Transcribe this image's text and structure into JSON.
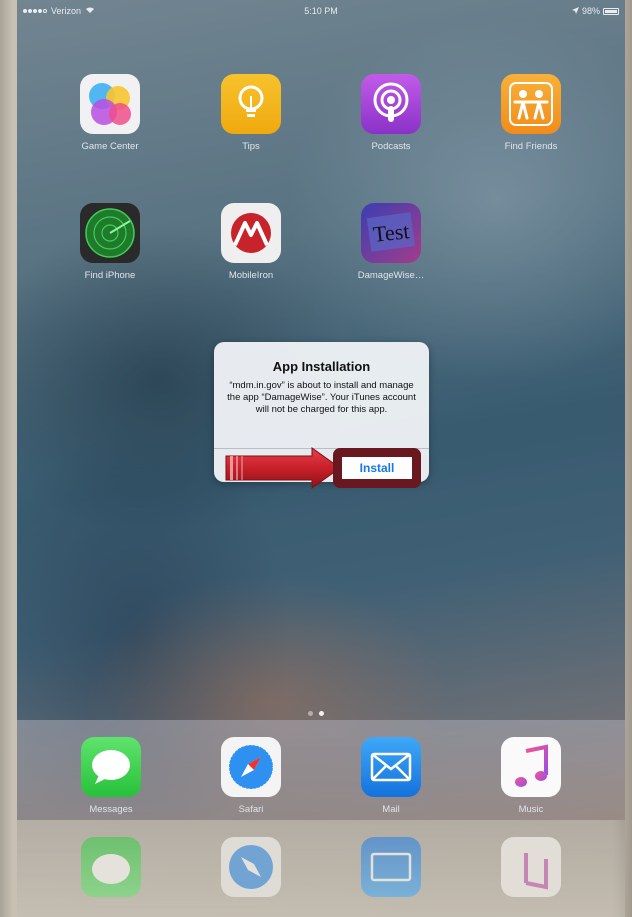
{
  "status_bar": {
    "carrier": "Verizon",
    "time": "5:10 PM",
    "battery": "98%"
  },
  "home_apps": [
    {
      "label": "Game Center",
      "icon": "game-center-icon"
    },
    {
      "label": "Tips",
      "icon": "tips-icon"
    },
    {
      "label": "Podcasts",
      "icon": "podcasts-icon"
    },
    {
      "label": "Find Friends",
      "icon": "find-friends-icon"
    },
    {
      "label": "Find iPhone",
      "icon": "find-iphone-icon"
    },
    {
      "label": "MobileIron",
      "icon": "mobileiron-icon"
    },
    {
      "label": "DamageWise…",
      "icon": "damagewise-icon",
      "icon_text": "Test"
    }
  ],
  "dock_apps": [
    {
      "label": "Messages",
      "icon": "messages-icon"
    },
    {
      "label": "Safari",
      "icon": "safari-icon"
    },
    {
      "label": "Mail",
      "icon": "mail-icon"
    },
    {
      "label": "Music",
      "icon": "music-icon"
    }
  ],
  "alert": {
    "title": "App Installation",
    "message": "“mdm.in.gov” is about to install and manage the app “DamageWise”. Your iTunes account will not be charged for this app.",
    "install_label": "Install"
  },
  "colors": {
    "annotation_red": "#c8202a",
    "highlight_border": "#6a1820",
    "ios_blue": "#1a78e6"
  }
}
